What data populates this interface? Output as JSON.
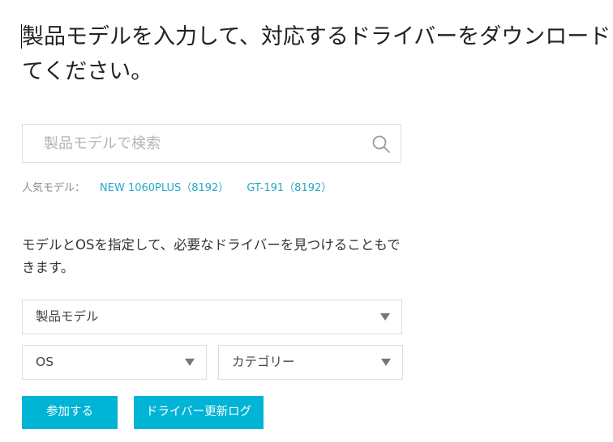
{
  "header": {
    "title": "製品モデルを入力して、対応するドライバーをダウンロードしてください。"
  },
  "search": {
    "placeholder": "製品モデルで検索",
    "value": "",
    "icon": "search-icon"
  },
  "popular": {
    "label": "人気モデル：",
    "models": [
      "NEW 1060PLUS（8192）",
      "GT-191（8192）"
    ],
    "link_color": "#27a8c4"
  },
  "filter": {
    "description": "モデルとOSを指定して、必要なドライバーを見つけることもできます。",
    "model_select": "製品モデル",
    "os_select": "OS",
    "category_select": "カテゴリー"
  },
  "actions": {
    "add_label": "参加する",
    "log_label": "ドライバー更新ログ",
    "accent_color": "#00b4d6"
  }
}
